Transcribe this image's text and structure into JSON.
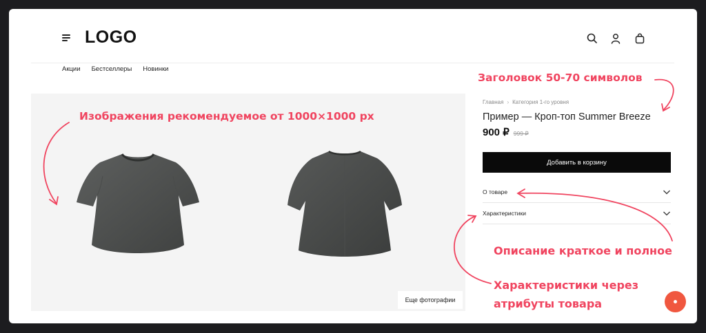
{
  "header": {
    "logo": "LOGO",
    "icons": [
      "menu-icon",
      "search-icon",
      "user-icon",
      "bag-icon"
    ]
  },
  "nav": {
    "items": [
      "Акции",
      "Бестселлеры",
      "Новинки"
    ]
  },
  "gallery": {
    "more_photos_label": "Еще фотографии"
  },
  "product": {
    "breadcrumb": [
      "Главная",
      "Категория 1-го уровня"
    ],
    "title": "Пример — Кроп-топ Summer Breeze",
    "price": "900 ₽",
    "old_price": "999 ₽",
    "add_to_cart": "Добавить в корзину",
    "accordion": [
      {
        "label": "О товаре"
      },
      {
        "label": "Характеристики"
      }
    ]
  },
  "annotations": {
    "title_hint": "Заголовок 50-70 символов",
    "image_hint": "Изображения рекомендуемое от 1000×1000 px",
    "description_hint": "Описание краткое и полное",
    "specs_hint_line1": "Характеристики через",
    "specs_hint_line2": "атрибуты товара"
  },
  "colors": {
    "accent": "#f0445f",
    "fab": "#f0573f",
    "button": "#0a0a0a",
    "gallery_bg": "#f4f4f4",
    "outer_bg": "#1c1c1f"
  }
}
